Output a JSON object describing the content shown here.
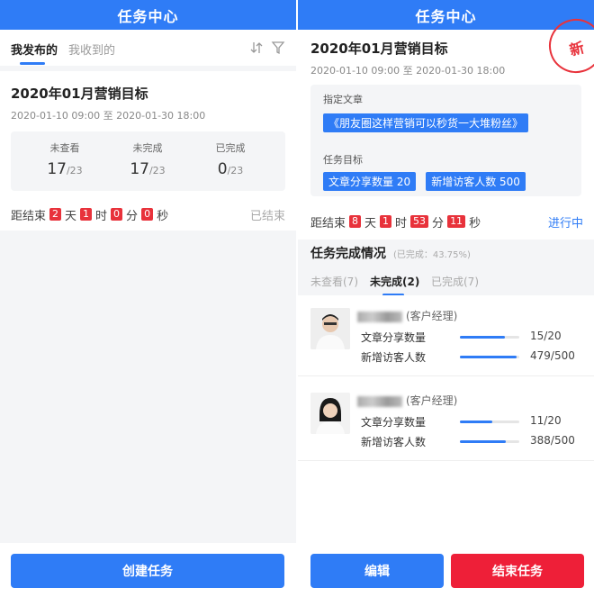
{
  "left": {
    "title": "任务中心",
    "tabs": [
      {
        "label": "我发布的",
        "active": true
      },
      {
        "label": "我收到的",
        "active": false
      }
    ],
    "icons": [
      "sort-icon",
      "filter-icon"
    ],
    "task": {
      "title": "2020年01月营销目标",
      "date_start": "2020-01-10 09:00",
      "date_sep": "至",
      "date_end": "2020-01-30 18:00",
      "stats": [
        {
          "label": "未查看",
          "value": "17",
          "total": "/23"
        },
        {
          "label": "未完成",
          "value": "17",
          "total": "/23"
        },
        {
          "label": "已完成",
          "value": "0",
          "total": "/23"
        }
      ],
      "countdown": {
        "prefix": "距结束",
        "days": "2",
        "day_unit": "天",
        "hours": "1",
        "hour_unit": "时",
        "minutes": "0",
        "minute_unit": "分",
        "seconds": "0",
        "second_unit": "秒",
        "status": "已结束"
      }
    },
    "create_button": "创建任务"
  },
  "right": {
    "title": "任务中心",
    "stamp": "新",
    "task": {
      "title": "2020年01月营销目标",
      "date_start": "2020-01-10 09:00",
      "date_sep": "至",
      "date_end": "2020-01-30 18:00",
      "assigned_label": "指定文章",
      "article": "《朋友圈这样营销可以秒货一大堆粉丝》",
      "goal_label": "任务目标",
      "goals": [
        "文章分享数量 20",
        "新增访客人数 500"
      ],
      "countdown": {
        "prefix": "距结束",
        "days": "8",
        "day_unit": "天",
        "hours": "1",
        "hour_unit": "时",
        "minutes": "53",
        "minute_unit": "分",
        "seconds": "11",
        "second_unit": "秒",
        "status": "进行中"
      }
    },
    "section": {
      "title": "任务完成情况",
      "subtitle": "(已完成：43.75%)"
    },
    "sub_tabs": [
      {
        "label": "未查看(7)",
        "active": false
      },
      {
        "label": "未完成(2)",
        "active": true
      },
      {
        "label": "已完成(7)",
        "active": false
      }
    ],
    "members": [
      {
        "role": "(客户经理)",
        "metrics": [
          {
            "label": "文章分享数量",
            "value": "15/20",
            "ratio": 0.75
          },
          {
            "label": "新增访客人数",
            "value": "479/500",
            "ratio": 0.958
          }
        ]
      },
      {
        "role": "(客户经理)",
        "metrics": [
          {
            "label": "文章分享数量",
            "value": "11/20",
            "ratio": 0.55
          },
          {
            "label": "新增访客人数",
            "value": "388/500",
            "ratio": 0.776
          }
        ]
      }
    ],
    "edit_button": "编辑",
    "end_button": "结束任务"
  },
  "colors": {
    "primary": "#2f7cf6",
    "danger": "#ee1f38",
    "countdown": "#e8323b",
    "bg": "#f4f5f7"
  }
}
